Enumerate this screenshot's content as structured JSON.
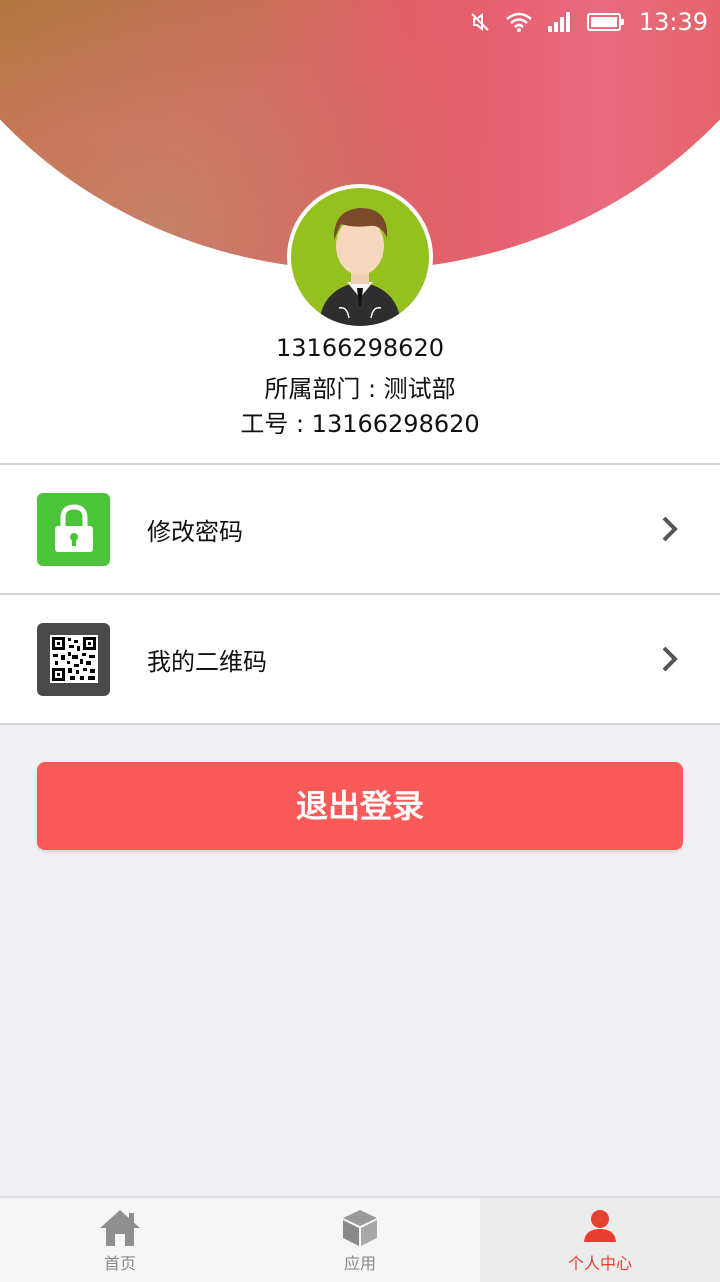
{
  "status_bar": {
    "time": "13:39",
    "icons": [
      "mute-icon",
      "wifi-icon",
      "signal-icon",
      "battery-icon"
    ]
  },
  "profile": {
    "phone": "13166298620",
    "department_line": "所属部门 : 测试部",
    "employee_id_line": "工号 : 13166298620"
  },
  "menu": {
    "items": [
      {
        "label": "修改密码",
        "icon": "lock-icon",
        "icon_bg": "#4cc43a"
      },
      {
        "label": "我的二维码",
        "icon": "qr-code-icon",
        "icon_bg": "#4a4a4a"
      }
    ]
  },
  "logout": {
    "label": "退出登录",
    "color": "#fa5a58"
  },
  "tabbar": {
    "tabs": [
      {
        "label": "首页",
        "icon": "home-icon",
        "active": false
      },
      {
        "label": "应用",
        "icon": "cube-icon",
        "active": false
      },
      {
        "label": "个人中心",
        "icon": "person-icon",
        "active": true
      }
    ],
    "active_color": "#e84030"
  }
}
